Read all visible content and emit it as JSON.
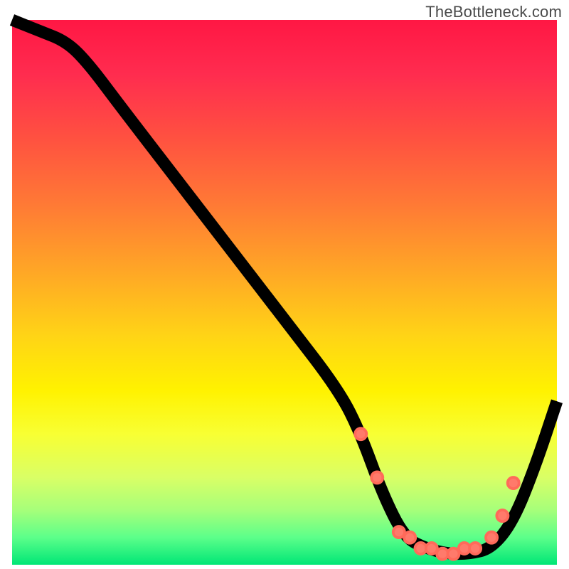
{
  "watermark": "TheBottleneck.com",
  "chart_data": {
    "type": "line",
    "title": "",
    "xlabel": "",
    "ylabel": "",
    "xlim": [
      0,
      100
    ],
    "ylim": [
      0,
      100
    ],
    "background": "green-yellow-red vertical gradient (green bottom, red top)",
    "series": [
      {
        "name": "bottleneck-curve",
        "x": [
          0,
          5,
          10,
          14,
          20,
          30,
          40,
          50,
          60,
          64,
          68,
          72,
          76,
          80,
          84,
          88,
          92,
          96,
          100
        ],
        "y": [
          100,
          98,
          96,
          92,
          84,
          71,
          58,
          45,
          32,
          24,
          13,
          5,
          3,
          2,
          2,
          3,
          8,
          18,
          30
        ]
      }
    ],
    "highlight_points": {
      "name": "optimal-range-dots",
      "x": [
        64,
        67,
        71,
        73,
        75,
        77,
        79,
        81,
        83,
        85,
        88,
        90,
        92
      ],
      "y": [
        24,
        16,
        6,
        5,
        3,
        3,
        2,
        2,
        3,
        3,
        5,
        9,
        15
      ]
    }
  }
}
